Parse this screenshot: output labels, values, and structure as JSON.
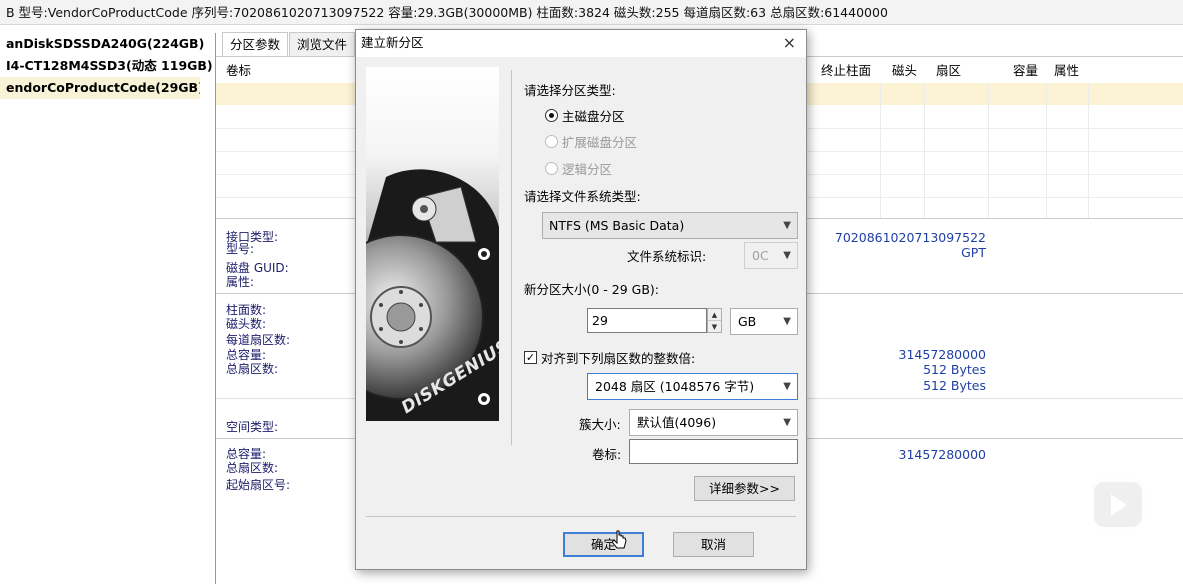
{
  "infobar": {
    "text": "B  型号:VendorCoProductCode  序列号:7020861020713097522  容量:29.3GB(30000MB)  柱面数:3824  磁头数:255  每道扇区数:63  总扇区数:61440000"
  },
  "disks": [
    {
      "label": "anDiskSDSSDA240G(224GB)"
    },
    {
      "label": "I4-CT128M4SSD3(动态 119GB)"
    },
    {
      "label": "endorCoProductCode(29GB)"
    }
  ],
  "tabs": [
    {
      "label": "分区参数"
    },
    {
      "label": "浏览文件"
    }
  ],
  "table": {
    "col_volume": "卷标",
    "col_end_cyl": "终止柱面",
    "col_head": "磁头",
    "col_sector": "扇区",
    "col_capacity": "容量",
    "col_attr": "属性"
  },
  "info": {
    "iface_label": "接口类型:",
    "model_label": "型号:",
    "guid_label": "磁盘 GUID:",
    "attr_label": "属性:",
    "serial_value": "7020861020713097522",
    "gpt_value": "GPT",
    "cyl_label": "柱面数:",
    "heads_label": "磁头数:",
    "spt_label": "每道扇区数:",
    "total_cap_label": "总容量:",
    "total_sec_label": "总扇区数:",
    "cap_value": "31457280000",
    "bytes1": "512 Bytes",
    "bytes2": "512 Bytes",
    "space_type_label": "空间类型:",
    "free_cap_label": "总容量:",
    "free_sec_label": "总扇区数:",
    "start_sec_label": "起始扇区号:",
    "free_cap_value": "31457280000"
  },
  "dialog": {
    "title": "建立新分区",
    "close": "×",
    "partition_type_label": "请选择分区类型:",
    "radio_primary": "主磁盘分区",
    "radio_extended": "扩展磁盘分区",
    "radio_logical": "逻辑分区",
    "fs_type_label": "请选择文件系统类型:",
    "fs_value": "NTFS (MS Basic Data)",
    "fs_id_label": "文件系统标识:",
    "fs_id_value": "0C",
    "size_label": "新分区大小(0 - 29 GB):",
    "size_value": "29",
    "size_unit": "GB",
    "align_check": "✓",
    "align_label": "对齐到下列扇区数的整数倍:",
    "align_value": "2048 扇区 (1048576 字节)",
    "cluster_label": "簇大小:",
    "cluster_value": "默认值(4096)",
    "volume_label": "卷标:",
    "volume_value": "",
    "details_button": "详细参数>>",
    "ok_button": "确定",
    "cancel_button": "取消",
    "logo_text": "DISKGENIUS"
  }
}
